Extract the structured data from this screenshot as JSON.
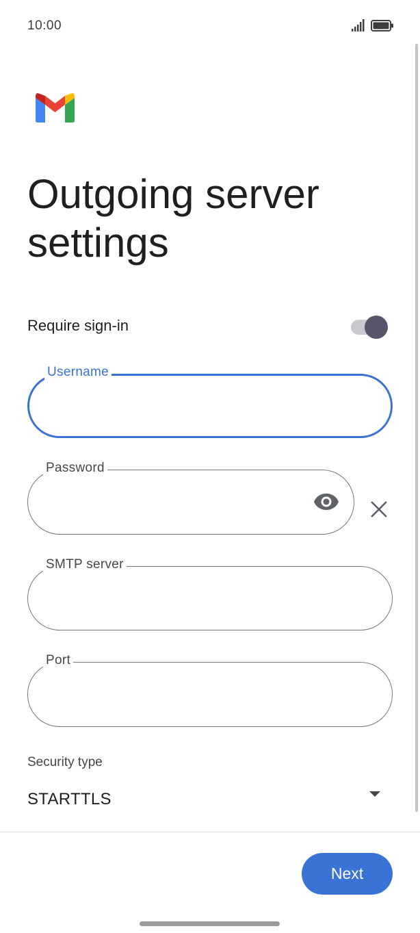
{
  "status_bar": {
    "time": "10:00",
    "signal_icon": "signal-bars-icon",
    "battery_icon": "battery-full-icon"
  },
  "app": {
    "logo": "gmail-logo",
    "colors": {
      "blue": "#4285F4",
      "red": "#EA4335",
      "yellow": "#FBBC04",
      "green": "#34A853",
      "dark_red": "#C5221F"
    }
  },
  "page": {
    "title": "Outgoing server settings"
  },
  "require_signin": {
    "label": "Require sign-in",
    "enabled": true
  },
  "fields": {
    "username": {
      "label": "Username",
      "value": "",
      "focused": true
    },
    "password": {
      "label": "Password",
      "value": "",
      "show_icon": "eye-icon",
      "clear_icon": "close-icon"
    },
    "smtp_server": {
      "label": "SMTP server",
      "value": ""
    },
    "port": {
      "label": "Port",
      "value": ""
    }
  },
  "security": {
    "label": "Security type",
    "selected": "STARTTLS",
    "dropdown_icon": "arrow-drop-down-icon"
  },
  "footer": {
    "next_label": "Next"
  },
  "theme": {
    "accent": "#3A73D6",
    "toggle_thumb": "#575569",
    "toggle_track": "#C9C9CF"
  }
}
